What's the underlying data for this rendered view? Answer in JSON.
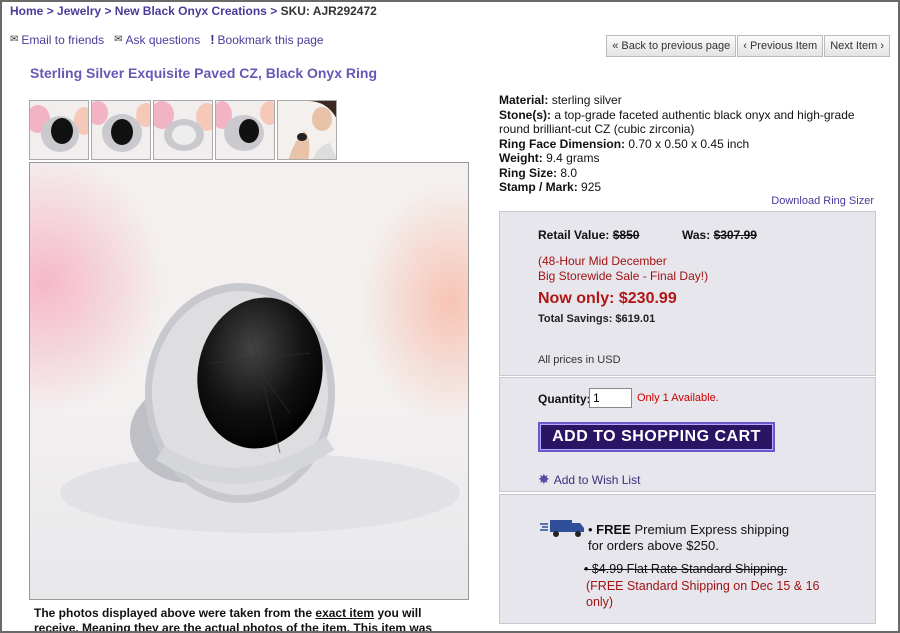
{
  "breadcrumb": {
    "home": "Home",
    "jewelry": "Jewelry",
    "category": "New Black Onyx Creations",
    "separator": ">",
    "sku": "SKU: AJR292472"
  },
  "utilities": {
    "email": "Email to friends",
    "questions": "Ask questions",
    "bookmark": "Bookmark this page"
  },
  "navigation": {
    "back": "« Back to previous page",
    "previous": "‹ Previous Item",
    "next": "Next Item ›"
  },
  "product": {
    "title": "Sterling Silver Exquisite Paved CZ, Black Onyx Ring"
  },
  "specs": {
    "material_label": "Material:",
    "material": "sterling silver",
    "stones_label": "Stone(s):",
    "stones": "a top-grade faceted authentic black onyx and high-grade round brilliant-cut CZ (cubic zirconia)",
    "face_label": "Ring Face Dimension:",
    "face": "0.70 x 0.50 x 0.45 inch",
    "weight_label": "Weight:",
    "weight": "9.4 grams",
    "size_label": "Ring Size:",
    "size": "8.0",
    "stamp_label": "Stamp / Mark:",
    "stamp": "925"
  },
  "sizer_link": "Download Ring Sizer",
  "pricing": {
    "retail_label": "Retail Value:",
    "retail": "$850",
    "was_label": "Was:",
    "was": "$307.99",
    "sale_line1": "(48-Hour Mid December",
    "sale_line2": "Big Storewide Sale - Final Day!)",
    "now": "Now only: $230.99",
    "savings": "Total Savings: $619.01",
    "currency_note": "All prices in USD"
  },
  "cart": {
    "quantity_label": "Quantity:",
    "quantity_value": "1",
    "availability": "Only 1 Available.",
    "add_button": "ADD TO SHOPPING CART",
    "wishlist": "Add to Wish List"
  },
  "shipping": {
    "free_word": "FREE",
    "free_rest": "Premium Express shipping",
    "free_line2": "for orders above $250.",
    "flat_rate": "$4.99 Flat Rate Standard Shipping.",
    "free_standard": "(FREE Standard Shipping on Dec 15 & 16 only)"
  },
  "disclaimer": {
    "part1": "The photos displayed above were taken from the",
    "exact": "exact item",
    "part2": "you will receive. Meaning they are the actual photos of the item. This item was handcrafted by"
  },
  "colors": {
    "link": "#4b3a9a",
    "title": "#6a56b4",
    "sale_red": "#b01616",
    "cart_button": "#2a1565",
    "panel": "#e6e6ec"
  }
}
